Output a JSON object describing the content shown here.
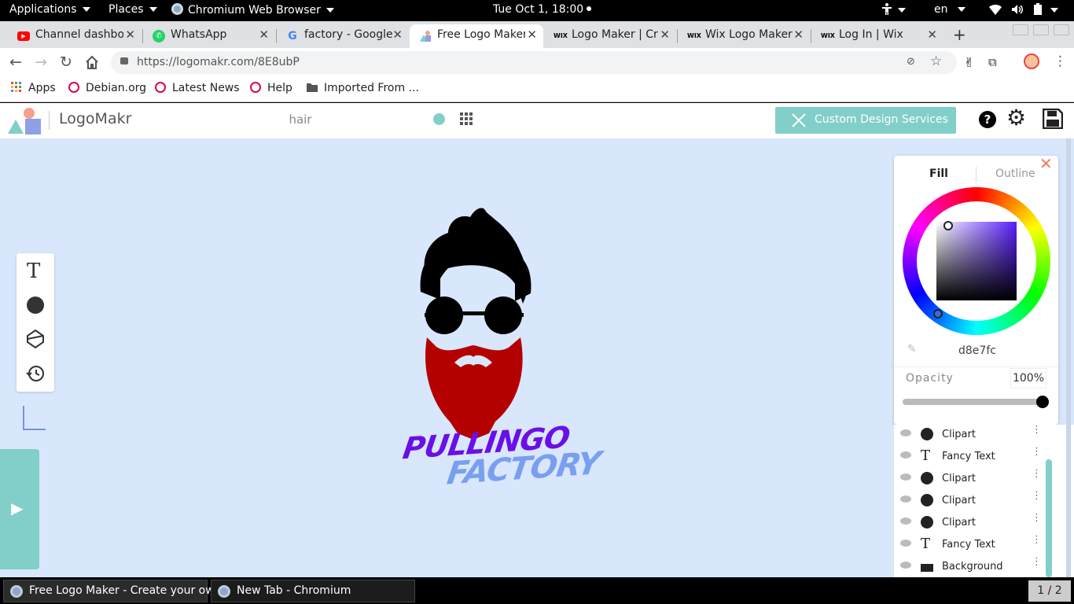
{
  "topbar": {
    "applications": "Applications",
    "places": "Places",
    "browser": "Chromium Web Browser",
    "clock": "Tue Oct  1, 18:00",
    "lang": "en"
  },
  "tabs": [
    {
      "title": "Channel dashboard",
      "favicon": "youtube-icon"
    },
    {
      "title": "WhatsApp",
      "favicon": "whatsapp-icon"
    },
    {
      "title": "factory - Google",
      "favicon": "google-icon"
    },
    {
      "title": "Free Logo Maker",
      "favicon": "logomakr-icon",
      "active": true
    },
    {
      "title": "Logo Maker | Cr",
      "favicon": "wix-icon"
    },
    {
      "title": "Wix Logo Maker",
      "favicon": "wix-icon"
    },
    {
      "title": "Log In | Wix",
      "favicon": "wix-icon"
    }
  ],
  "toolbar": {
    "url": "https://logomakr.com/8E8ubP"
  },
  "bookmarks": [
    {
      "label": "Apps",
      "icon": "apps-grid-icon"
    },
    {
      "label": "Debian.org",
      "icon": "debian-icon"
    },
    {
      "label": "Latest News",
      "icon": "debian-icon"
    },
    {
      "label": "Help",
      "icon": "debian-icon"
    },
    {
      "label": "Imported From ...",
      "icon": "folder-icon"
    }
  ],
  "app": {
    "logo_text": "LogoMakr",
    "search_value": "hair",
    "custom_design": "Custom Design Services"
  },
  "artwork": {
    "text1": "PULLINGO",
    "text2": "FACTORY",
    "text1_color": "#6a0fe8",
    "text2_color": "#7a9ff0",
    "beard_color": "#b50000"
  },
  "color_panel": {
    "tab_fill": "Fill",
    "tab_outline": "Outline",
    "hex": "d8e7fc",
    "opacity_label": "Opacity",
    "opacity_value": "100%"
  },
  "layers": [
    {
      "name": "Clipart",
      "icon": "clipart-icon"
    },
    {
      "name": "Fancy Text",
      "icon": "text-icon"
    },
    {
      "name": "Clipart",
      "icon": "clipart-icon"
    },
    {
      "name": "Clipart",
      "icon": "clipart-icon"
    },
    {
      "name": "Clipart",
      "icon": "clipart-icon"
    },
    {
      "name": "Fancy Text",
      "icon": "text-icon"
    },
    {
      "name": "Background",
      "icon": "background-icon"
    }
  ],
  "taskbar": {
    "task1": "Free Logo Maker - Create your ow...",
    "task2": "New Tab - Chromium",
    "pager": "1 / 2"
  },
  "colors": {
    "canvas_bg": "#d8e7fc",
    "accent": "#81cfc8"
  }
}
